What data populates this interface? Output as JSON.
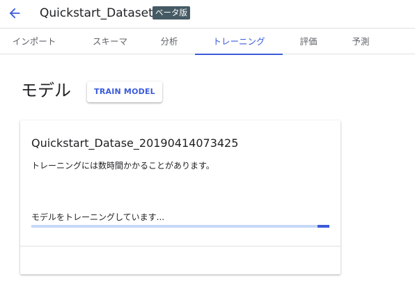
{
  "header": {
    "title": "Quickstart_Dataset",
    "badge": "ベータ版",
    "back_icon": "arrow-back-icon",
    "accent_color": "#3b5bdb"
  },
  "tabs": [
    {
      "label": "インポート",
      "active": false
    },
    {
      "label": "スキーマ",
      "active": false
    },
    {
      "label": "分析",
      "active": false
    },
    {
      "label": "トレーニング",
      "active": true
    },
    {
      "label": "評価",
      "active": false
    },
    {
      "label": "予測",
      "active": false
    }
  ],
  "main": {
    "section_title": "モデル",
    "train_button_label": "TRAIN MODEL",
    "card": {
      "model_name": "Quickstart_Datase_20190414073425",
      "training_note": "トレーニングには数時間かかることがあります。",
      "progress_label": "モデルをトレーニングしています...",
      "progress": {
        "indeterminate": true,
        "indicator_position": 0.96,
        "indicator_fraction": 0.04
      }
    }
  }
}
